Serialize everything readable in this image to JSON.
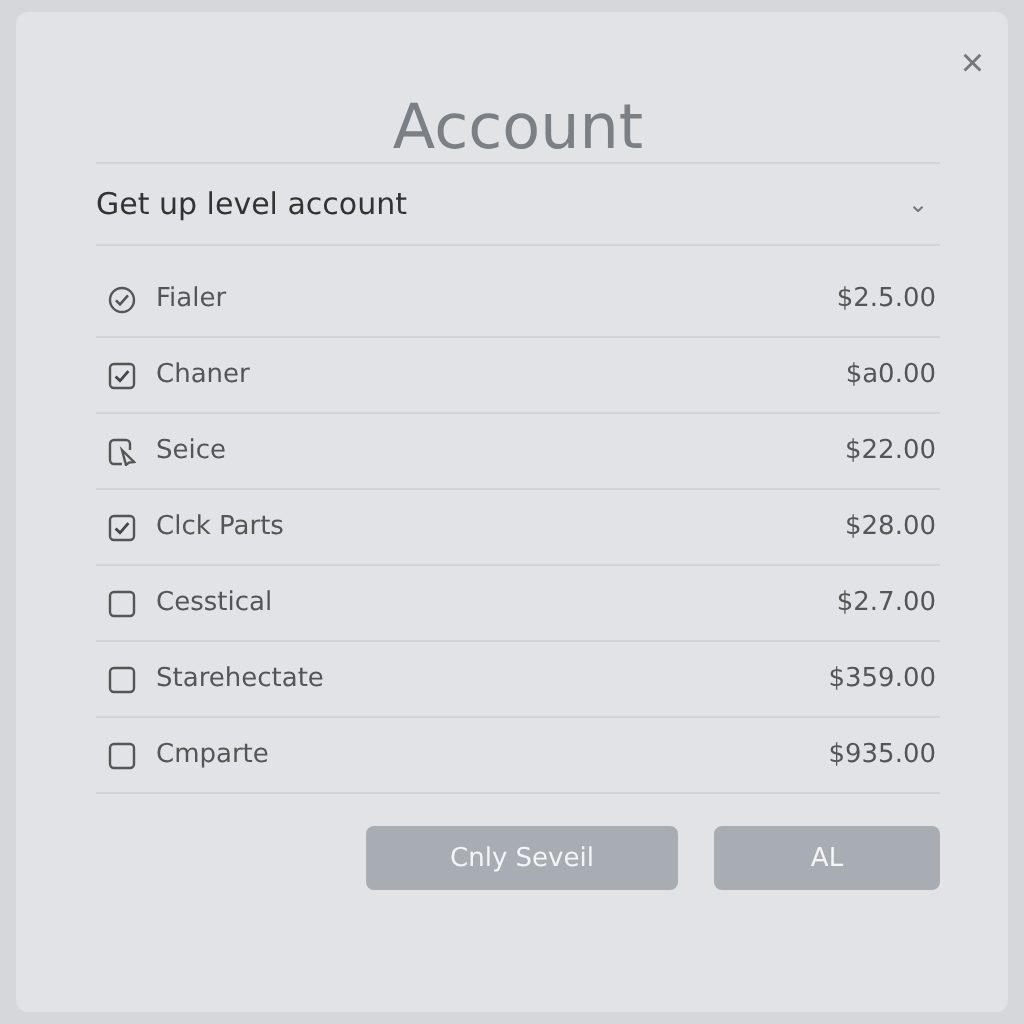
{
  "dialog": {
    "title": "Account",
    "close": "×"
  },
  "dropdown": {
    "label": "Get up level account",
    "caret": "⌄"
  },
  "items": [
    {
      "kind": "circle-check",
      "label": "Fialer",
      "price": "$2.5.00",
      "checked": true
    },
    {
      "kind": "checkbox",
      "label": "Chaner",
      "price": "$a0.00",
      "checked": true
    },
    {
      "kind": "pointer",
      "label": "Seice",
      "price": "$22.00"
    },
    {
      "kind": "checkbox",
      "label": "Clck Parts",
      "price": "$28.00",
      "checked": true
    },
    {
      "kind": "checkbox",
      "label": "Cesstical",
      "price": "$2.7.00",
      "checked": false
    },
    {
      "kind": "checkbox",
      "label": "Starehectate",
      "price": "$359.00",
      "checked": false
    },
    {
      "kind": "checkbox",
      "label": "Cmparte",
      "price": "$935.00",
      "checked": false
    }
  ],
  "buttons": [
    "Cnly Seveil",
    "AL"
  ]
}
